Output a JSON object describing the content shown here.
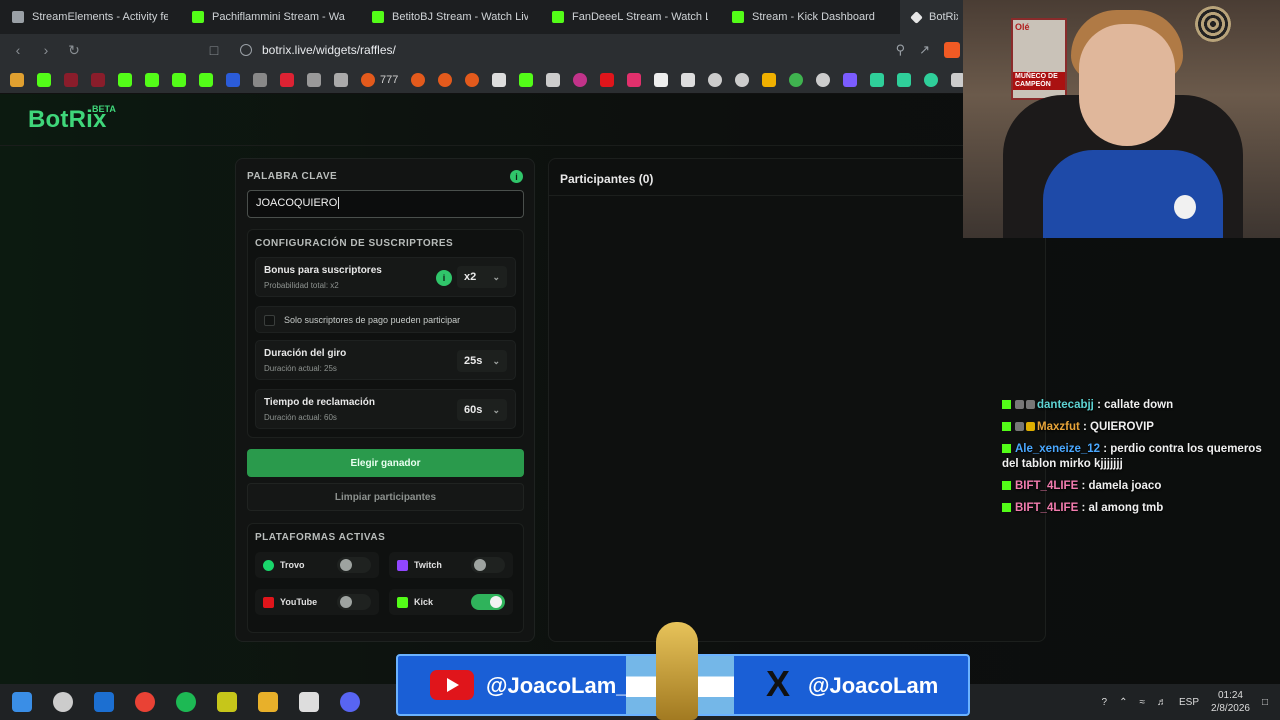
{
  "browser": {
    "tabs": [
      {
        "label": "StreamElements - Activity feed",
        "icon": "streamelements-icon"
      },
      {
        "label": "Pachiflammini Stream - Wa",
        "icon": "kick-icon"
      },
      {
        "label": "BetitoBJ Stream - Watch Liv",
        "icon": "kick-icon"
      },
      {
        "label": "FanDeeeL Stream - Watch L",
        "icon": "kick-icon"
      },
      {
        "label": "Stream - Kick Dashboard",
        "icon": "kick-icon"
      },
      {
        "label": "BotRix |",
        "icon": "botrix-icon"
      }
    ],
    "url": "botrix.live/widgets/raffles/",
    "bookmark_text": "777"
  },
  "app": {
    "logo": "BotRix",
    "logo_badge": "BETA",
    "keyword_label": "PALABRA CLAVE",
    "keyword_value": "JOACOQUIERO",
    "subs_title": "CONFIGURACIÓN DE SUSCRIPTORES",
    "bonus_title": "Bonus para suscriptores",
    "bonus_sub": "Probabilidad total: x2",
    "bonus_value": "x2",
    "paid_only_label": "Solo suscriptores de pago pueden participar",
    "spin_title": "Duración del giro",
    "spin_sub": "Duración actual: 25s",
    "spin_value": "25s",
    "claim_title": "Tiempo de reclamación",
    "claim_sub": "Duración actual: 60s",
    "claim_value": "60s",
    "pick_winner": "Elegir ganador",
    "clear_participants": "Limpiar participantes",
    "platforms_title": "PLATAFORMAS ACTIVAS",
    "platforms": [
      {
        "name": "Trovo",
        "enabled": false,
        "color": "#19d66b"
      },
      {
        "name": "Twitch",
        "enabled": false,
        "color": "#9146ff"
      },
      {
        "name": "YouTube",
        "enabled": false,
        "color": "#e0151b"
      },
      {
        "name": "Kick",
        "enabled": true,
        "color": "#53fc18"
      }
    ],
    "participants_title": "Participantes (0)"
  },
  "chat": [
    {
      "user": "dantecabjj",
      "text": ": callate down"
    },
    {
      "user": "Maxzfut",
      "text": ": QUIEROVIP"
    },
    {
      "user": "Ale_xeneize_12",
      "text": ": perdio contra los quemeros del tablon mirko kjjjjjjj"
    },
    {
      "user": "BIFT_4LIFE",
      "text": ": damela joaco"
    },
    {
      "user": "BIFT_4LIFE",
      "text": ": al among tmb"
    }
  ],
  "webcam": {
    "poster_top": "Olé",
    "poster_bottom": "MUÑECO DE CAMPEÓN"
  },
  "banner": {
    "youtube_handle": "@JoacoLam_",
    "x_handle": "@JoacoLam",
    "x_glyph": "X"
  },
  "taskbar": {
    "lang": "ESP",
    "time": "01:24",
    "date": "2/8/2026"
  },
  "colors": {
    "accent": "#2a9a4c",
    "logo": "#3fd67a",
    "kick": "#53fc18"
  }
}
